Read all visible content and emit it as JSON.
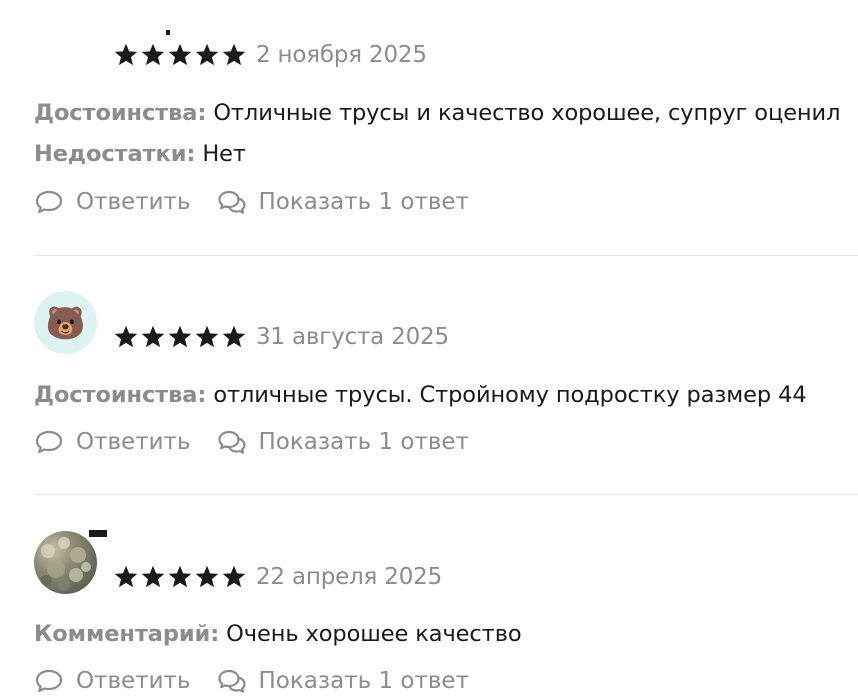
{
  "colors": {
    "star": "#1a1a1a",
    "muted": "#8c8c8c",
    "text": "#1a1a1a",
    "divider": "#e6e6e6",
    "bear_avatar_bg": "#dcf3f1"
  },
  "icons": {
    "star": "star-icon",
    "reply": "speech-bubble-icon",
    "replies": "two-speech-bubbles-icon",
    "bear": "bear-face-emoji"
  },
  "reviews": [
    {
      "rating": 5,
      "date": "2 ноября 2025",
      "fields": [
        {
          "label": "Достоинства:",
          "value": "Отличные трусы и качество хорошее, супруг оценил"
        },
        {
          "label": "Недостатки:",
          "value": "Нет"
        }
      ],
      "reply_label": "Ответить",
      "show_replies_label": "Показать 1 ответ"
    },
    {
      "avatar": "🐻",
      "rating": 5,
      "date": "31 августа 2025",
      "fields": [
        {
          "label": "Достоинства:",
          "value": "отличные трусы. Стройному подростку размер 44"
        }
      ],
      "reply_label": "Ответить",
      "show_replies_label": "Показать 1 ответ"
    },
    {
      "rating": 5,
      "date": "22 апреля 2025",
      "fields": [
        {
          "label": "Комментарий:",
          "value": "Очень хорошее качество"
        }
      ],
      "reply_label": "Ответить",
      "show_replies_label": "Показать 1 ответ"
    }
  ]
}
